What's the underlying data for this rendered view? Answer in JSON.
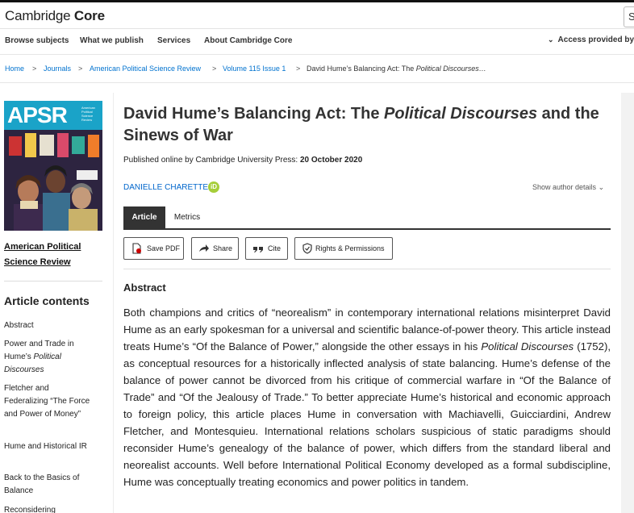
{
  "header": {
    "logo_main": "Cambridge",
    "logo_bold": "Core",
    "search_stub": "S"
  },
  "nav": {
    "items": [
      "Browse subjects",
      "What we publish",
      "Services",
      "About Cambridge Core"
    ],
    "access": "Access provided by"
  },
  "breadcrumb": {
    "items": [
      "Home",
      "Journals",
      "American Political Science Review",
      "Volume 115 Issue 1"
    ],
    "current_plain": "David Hume’s Balancing Act: The ",
    "current_italic": "Political Discourses…"
  },
  "sidebar": {
    "cover_title": "APSR",
    "cover_subtitle": "American Political Science Review",
    "journal_link": "American Political Science Review",
    "contents_title": "Article contents",
    "contents": [
      {
        "plain": "Abstract",
        "italic": ""
      },
      {
        "plain": "Power and Trade in Hume’s ",
        "italic": "Political Discourses"
      },
      {
        "plain": "Fletcher and Federalizing “The Force and Power of Money”",
        "italic": ""
      },
      {
        "plain": "Hume and Historical IR",
        "italic": ""
      },
      {
        "plain": "Back to the Basics of Balance",
        "italic": ""
      },
      {
        "plain": "Reconsidering",
        "italic": ""
      }
    ]
  },
  "article": {
    "title_part1": "David Hume’s Balancing Act: The ",
    "title_italic": "Political Discourses",
    "title_part2": " and the Sinews of War",
    "published_prefix": "Published online by Cambridge University Press: ",
    "published_date": "20 October 2020",
    "author": "DANIELLE CHARETTE",
    "orcid_label": "iD",
    "show_author": "Show author details",
    "tabs": [
      "Article",
      "Metrics"
    ],
    "actions": [
      "Save PDF",
      "Share",
      "Cite",
      "Rights & Permissions"
    ],
    "abstract_title": "Abstract",
    "abstract_a": "Both champions and critics of “neorealism” in contemporary international relations misinterpret David Hume as an early spokesman for a universal and scientific balance-of-power theory. This article instead treats Hume’s “Of the Balance of Power,” alongside the other essays in his ",
    "abstract_italic": "Political Discourses",
    "abstract_b": " (1752), as conceptual resources for a historically inflected analysis of state balancing. Hume’s defense of the balance of power cannot be divorced from his critique of commercial warfare in “Of the Balance of Trade” and “Of the Jealousy of Trade.” To better appreciate Hume’s historical and economic approach to foreign policy, this article places Hume in conversation with Machiavelli, Guicciardini, Andrew Fletcher, and Montesquieu. International relations scholars suspicious of static paradigms should reconsider Hume’s genealogy of the balance of power, which differs from the standard liberal and neorealist accounts. Well before International Political Economy developed as a formal subdiscipline, Hume was conceptually treating economics and power politics in tandem."
  },
  "colors": {
    "link": "#0072cf",
    "cover_accent": "#1aa3c8",
    "orcid": "#a6ce39",
    "tab_active": "#333333"
  }
}
